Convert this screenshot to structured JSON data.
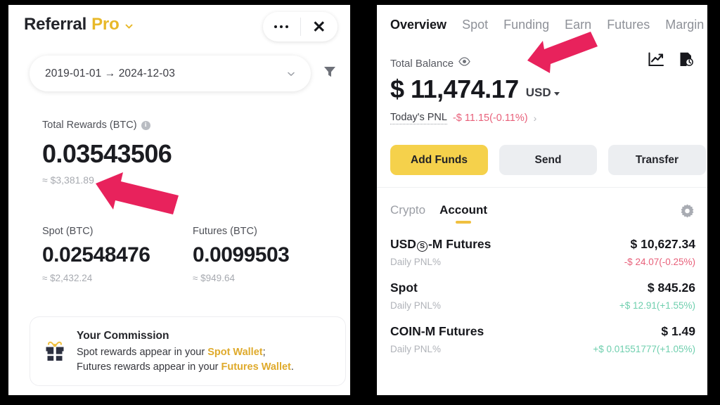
{
  "accent": {
    "gold": "#e8b828",
    "yellow_button": "#f5d14b",
    "arrow_pink": "#e8225c",
    "negative_red": "#e8607a",
    "positive_green": "#6fcfae"
  },
  "referral_panel": {
    "title": "Referral",
    "title_badge": "Pro",
    "chevron_icon": "chevron-down-icon",
    "more_icon": "more-dots-icon",
    "close_icon": "close-icon",
    "date_range": {
      "value": "2019-01-01 → 2024-12-03",
      "chevron_icon": "chevron-down-icon",
      "filter_icon": "filter-icon"
    },
    "total_rewards": {
      "label": "Total Rewards (BTC)",
      "info_icon": "info-icon",
      "value": "0.03543506",
      "approx": "≈ $3,381.89"
    },
    "spot": {
      "label": "Spot (BTC)",
      "value": "0.02548476",
      "approx": "≈ $2,432.24"
    },
    "futures": {
      "label": "Futures (BTC)",
      "value": "0.0099503",
      "approx": "≈ $949.64"
    },
    "commission_card": {
      "icon": "gift-icon",
      "title": "Your Commission",
      "line1_a": "Spot rewards appear in your ",
      "line1_link": "Spot Wallet",
      "line1_b": ";",
      "line2_a": "Futures rewards appear in your ",
      "line2_link": "Futures Wallet",
      "line2_b": "."
    }
  },
  "wallet_panel": {
    "tabs": [
      {
        "label": "Overview",
        "active": true
      },
      {
        "label": "Spot",
        "active": false
      },
      {
        "label": "Funding",
        "active": false
      },
      {
        "label": "Earn",
        "active": false
      },
      {
        "label": "Futures",
        "active": false
      },
      {
        "label": "Margin",
        "active": false
      }
    ],
    "total_balance": {
      "label": "Total Balance",
      "eye_icon": "eye-icon",
      "amount": "$ 11,474.17",
      "currency": "USD",
      "currency_caret_icon": "caret-down-icon"
    },
    "todays_pnl": {
      "label": "Today's PNL",
      "value": "-$ 11.15(-0.11%)",
      "arrow_icon": "chevron-right-icon"
    },
    "header_icons": {
      "chart_icon": "line-chart-icon",
      "history_icon": "document-history-icon"
    },
    "actions": {
      "add_funds": "Add Funds",
      "send": "Send",
      "transfer": "Transfer"
    },
    "subtabs": [
      {
        "label": "Crypto",
        "active": false
      },
      {
        "label": "Account",
        "active": true
      }
    ],
    "settings_icon": "gear-icon",
    "accounts": [
      {
        "name_pre": "USD",
        "name_badge": "S",
        "name_post": "-M Futures",
        "amount": "$ 10,627.34",
        "pnl_label": "Daily PNL%",
        "pnl_value": "-$ 24.07(-0.25%)",
        "pnl_sign": "neg"
      },
      {
        "name_pre": "Spot",
        "name_badge": "",
        "name_post": "",
        "amount": "$ 845.26",
        "pnl_label": "Daily PNL%",
        "pnl_value": "+$ 12.91(+1.55%)",
        "pnl_sign": "pos"
      },
      {
        "name_pre": "COIN-M Futures",
        "name_badge": "",
        "name_post": "",
        "amount": "$ 1.49",
        "pnl_label": "Daily PNL%",
        "pnl_value": "+$ 0.01551777(+1.05%)",
        "pnl_sign": "pos"
      }
    ]
  },
  "annotations": {
    "arrow_left": "pink-arrow-pointing-left",
    "arrow_right": "pink-arrow-pointing-left"
  }
}
